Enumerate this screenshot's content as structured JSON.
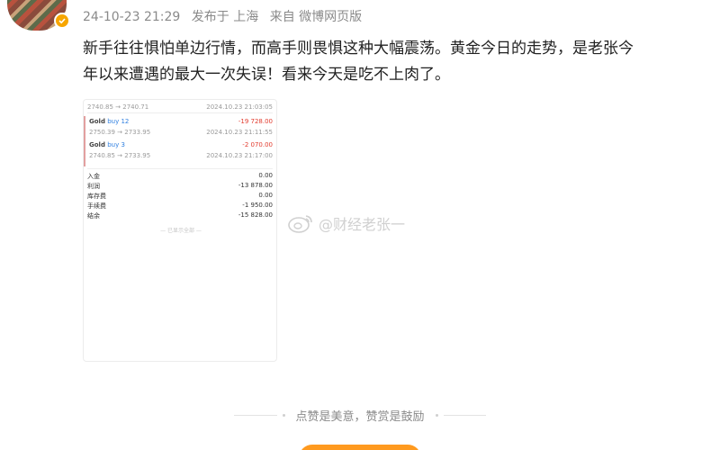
{
  "post": {
    "meta": {
      "timestamp": "24-10-23 21:29",
      "location": "发布于 上海",
      "source": "来自 微博网页版"
    },
    "text_line1": "新手往往惧怕单边行情，而高手则畏惧这种大幅震荡。黄金今日的走势，是老张今",
    "text_line2": "年以来遭遇的最大一次失误！看来今天是吃不上肉了。"
  },
  "trade_card": {
    "header_left": "2740.85 → 2740.71",
    "header_right": "2024.10.23 21:03:05",
    "trades": [
      {
        "asset": "Gold",
        "side": "buy 12",
        "price_path": "2750.39 → 2733.95",
        "pnl": "-19 728.00",
        "time": "2024.10.23 21:11:55"
      },
      {
        "asset": "Gold",
        "side": "buy 3",
        "price_path": "2740.85 → 2733.95",
        "pnl": "-2 070.00",
        "time": "2024.10.23 21:17:00"
      }
    ],
    "summary": [
      {
        "label": "入金",
        "value": "0.00"
      },
      {
        "label": "利润",
        "value": "-13 878.00"
      },
      {
        "label": "库存费",
        "value": "0.00"
      },
      {
        "label": "手续费",
        "value": "-1 950.00"
      },
      {
        "label": "结余",
        "value": "-15 828.00"
      }
    ],
    "more": "— 已显示全部 —"
  },
  "watermark": "@财经老张一",
  "reward": {
    "text": "点赞是美意，赞赏是鼓励"
  },
  "colors": {
    "verified_badge": "#f7a600",
    "loss": "#e23b2e",
    "buy": "#2f7fe0",
    "reward_button": "#ff9a1f"
  }
}
